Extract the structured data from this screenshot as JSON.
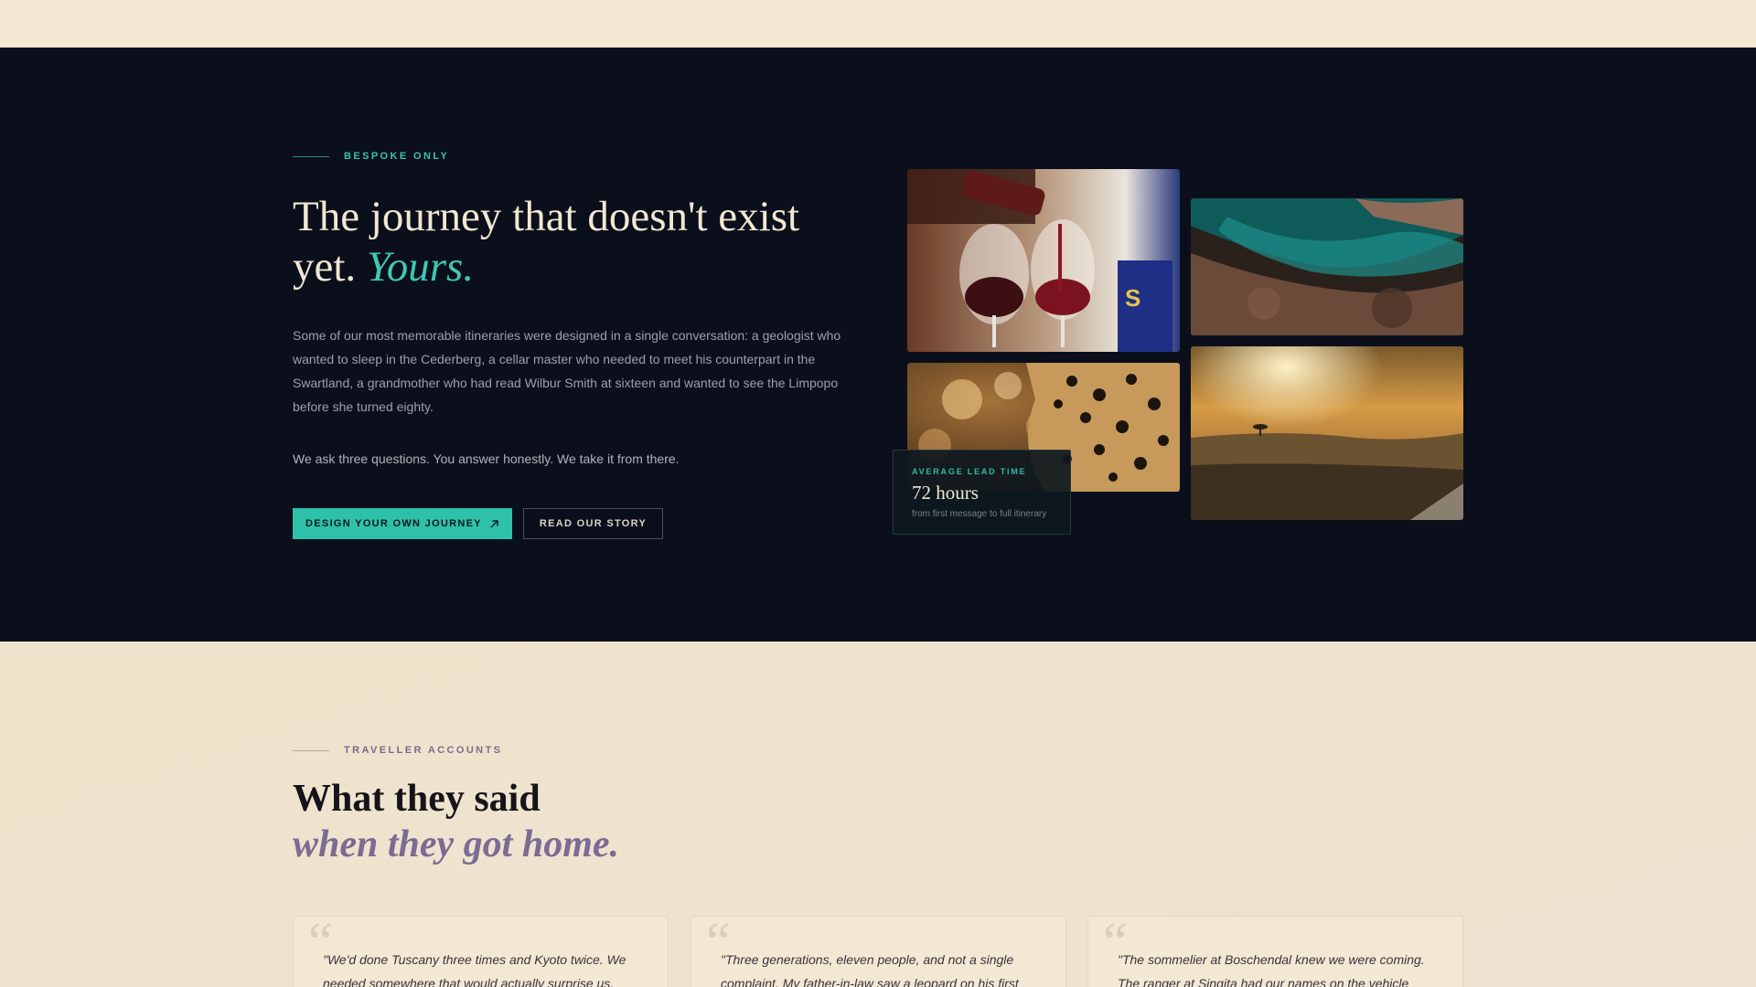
{
  "hero": {
    "eyebrow": "BESPOKE ONLY",
    "title_main": "The journey that doesn't exist yet.",
    "title_accent": "Yours.",
    "body": "Some of our most memorable itineraries were designed in a single conversation: a geologist who wanted to sleep in the Cederberg, a cellar master who needed to meet his counterpart in the Swartland, a grandmother who had read Wilbur Smith at sixteen and wanted to see the Limpopo before she turned eighty.",
    "body2": "We ask three questions. You answer honestly. We take it from there.",
    "primary_button": "DESIGN YOUR OWN JOURNEY",
    "primary_button_icon": "arrow-up-right-icon",
    "secondary_button": "READ OUR STORY",
    "lead_card": {
      "label": "AVERAGE LEAD TIME",
      "value": "72 hours",
      "sub": "from first message to full itinerary"
    },
    "colors": {
      "background": "#0b0f1b",
      "accent": "#2fc0aa",
      "heading": "#f2e7d2"
    }
  },
  "accounts": {
    "eyebrow": "TRAVELLER ACCOUNTS",
    "title_line1": "What they said",
    "title_line2": "when they got home.",
    "quotes": [
      {
        "mark": "“",
        "text": "\"We'd done Tuscany three times and Kyoto twice. We needed somewhere that would actually surprise us."
      },
      {
        "mark": "“",
        "text": "\"Three generations, eleven people, and not a single complaint. My father-in-law saw a leopard on his first"
      },
      {
        "mark": "“",
        "text": "\"The sommelier at Boschendal knew we were coming. The ranger at Singita had our names on the vehicle"
      }
    ],
    "colors": {
      "background": "#efe4ce",
      "accent": "#7c6b93"
    }
  }
}
